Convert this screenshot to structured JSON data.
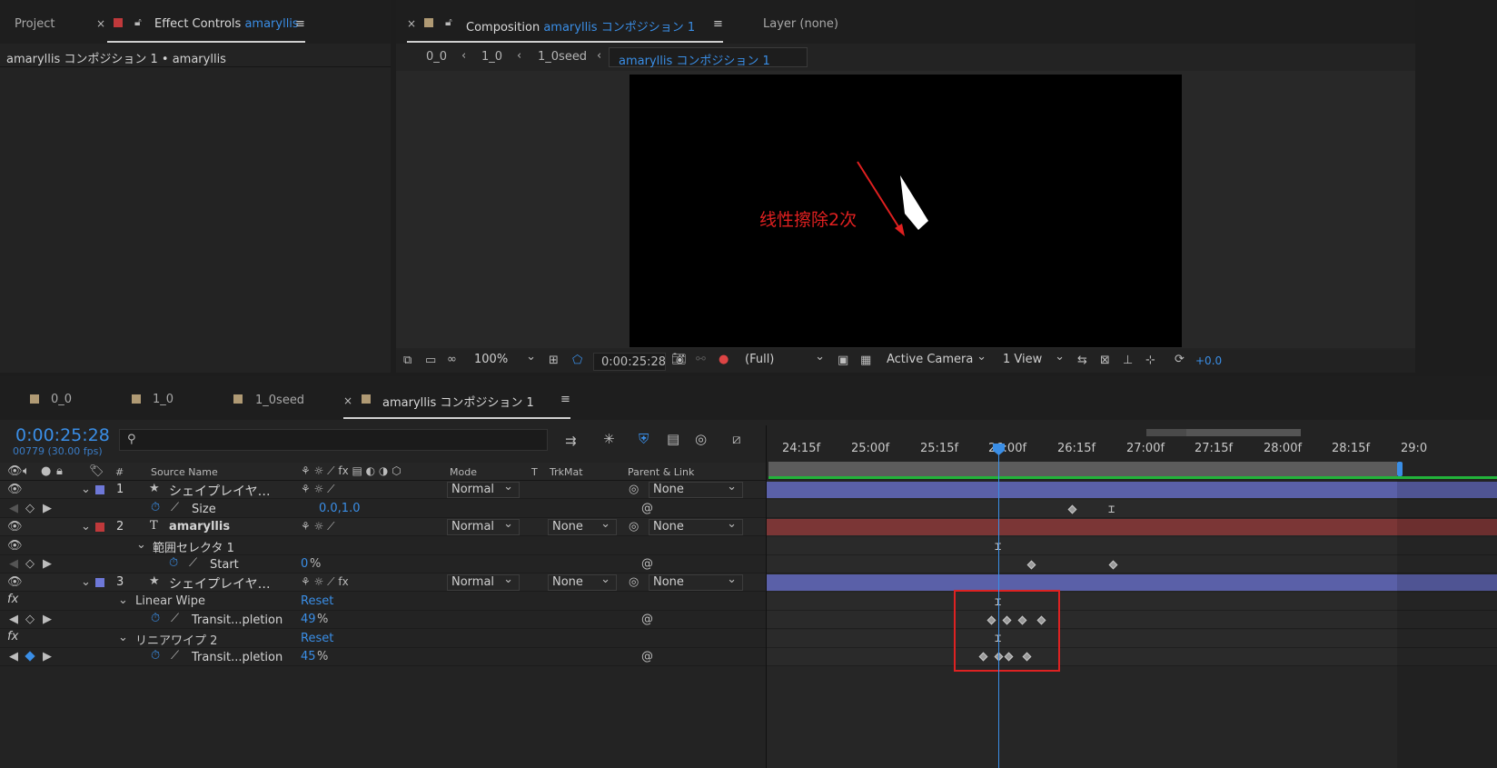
{
  "project_panel": {
    "tab_project": "Project",
    "tab_effect_controls": "Effect Controls",
    "effect_controls_target": "amaryllis",
    "breadcrumb": "amaryllis コンポジション 1 • amaryllis"
  },
  "composition_panel": {
    "tab_label": "Composition",
    "comp_name": "amaryllis コンポジション 1",
    "layer_tab": "Layer  (none)",
    "crumbs": [
      "0_0",
      "1_0",
      "1_0seed",
      "amaryllis コンポジション 1"
    ],
    "annotation": "线性擦除2次",
    "toolbar": {
      "zoom": "100%",
      "timecode": "0:00:25:28",
      "resolution": "(Full)",
      "camera": "Active Camera",
      "view": "1 View",
      "exposure": "+0.0"
    }
  },
  "timeline": {
    "tabs": [
      "0_0",
      "1_0",
      "1_0seed",
      "amaryllis コンポジション 1"
    ],
    "current_time": "0:00:25:28",
    "frame_info": "00779 (30.00 fps)",
    "search_placeholder": "",
    "columns": {
      "hash": "#",
      "source_name": "Source Name",
      "mode": "Mode",
      "t": "T",
      "trkmat": "TrkMat",
      "parent": "Parent & Link"
    },
    "ruler": [
      "24:15f",
      "25:00f",
      "25:15f",
      "26:00f",
      "26:15f",
      "27:00f",
      "27:15f",
      "28:00f",
      "28:15f",
      "29:0"
    ],
    "rows": {
      "l1_num": "1",
      "l1_name": "シェイプレイヤ…",
      "l1_mode": "Normal",
      "l1_parent": "None",
      "l1_prop": "Size",
      "l1_prop_val": "0.0,1.0",
      "l2_num": "2",
      "l2_name": "amaryllis",
      "l2_mode": "Normal",
      "l2_trkmat": "None",
      "l2_parent": "None",
      "l2_group": "範囲セレクタ 1",
      "l2_prop": "Start",
      "l2_prop_val": "0",
      "l2_prop_unit": "%",
      "l3_num": "3",
      "l3_name": "シェイプレイヤ…",
      "l3_mode": "Normal",
      "l3_trkmat": "None",
      "l3_parent": "None",
      "fx1_name": "Linear Wipe",
      "fx1_reset": "Reset",
      "fx1_prop": "Transit...pletion",
      "fx1_val": "49",
      "fx1_unit": "%",
      "fx2_name": "リニアワイプ 2",
      "fx2_reset": "Reset",
      "fx2_prop": "Transit...pletion",
      "fx2_val": "45",
      "fx2_unit": "%"
    }
  },
  "colors": {
    "accent_blue": "#3a8ee6",
    "label_purple": "#6e78d8",
    "label_red": "#c0393b",
    "annotation_red": "#e02020"
  }
}
